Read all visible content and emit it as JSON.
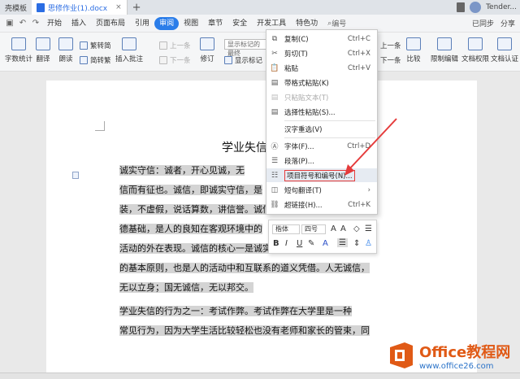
{
  "titlebar": {
    "tab1": "壳模板",
    "tab2": "思修作业(1).docx",
    "user": "Tender..."
  },
  "menubar": {
    "items": [
      "开始",
      "插入",
      "页面布局",
      "引用",
      "审阅",
      "视图",
      "章节",
      "安全",
      "开发工具",
      "特色功"
    ],
    "search": "编号",
    "sync": "已同步",
    "share": "分享"
  },
  "ribbon": {
    "word_count": "字数统计",
    "translate": "翻译",
    "read_aloud": "朗读",
    "trad_to_simp": "繁转简",
    "simp_to_trad": "简转繁",
    "insert_comment": "插入批注",
    "prev": "上一条",
    "next": "下一条",
    "revise": "修订",
    "show_markup": "显示标记的最终",
    "show_markup_opt": "显示标记",
    "prev2": "上一条",
    "next2": "下一条",
    "compare": "比较",
    "restrict": "限制编辑",
    "doc_rights": "文档权限",
    "doc_cert": "文档认证"
  },
  "document": {
    "title": "学业失信",
    "lines": [
      "诚实守信：诚者，开心见诚，无",
      "信而有征也。诚信，即诚实守信，是",
      "装，不虚假，说话算数，讲信誉。诚信是一个社会赖以存在的道",
      "德基础，是人的良知在客观环境中的",
      "活动的外在表现。诚信的核心一是诚实，二是守信。诚信是做人",
      "的基本原则，也是人的活动中和互联系的道义凭借。人无诚信，",
      "无以立身；国无诚信，无以邦交。",
      "学业失信的行为之一：考试作弊。考试作弊在大学里是一种",
      "常见行为，因为大学生活比较轻松也没有老师和家长的管束，同"
    ]
  },
  "context_menu": {
    "items": [
      {
        "label": "复制(C)",
        "shortcut": "Ctrl+C"
      },
      {
        "label": "剪切(T)",
        "shortcut": "Ctrl+X"
      },
      {
        "label": "粘贴",
        "shortcut": "Ctrl+V"
      },
      {
        "label": "带格式粘贴(K)",
        "shortcut": ""
      },
      {
        "label": "只粘贴文本(T)",
        "shortcut": ""
      },
      {
        "label": "选择性粘贴(S)...",
        "shortcut": ""
      },
      {
        "label": "汉字重选(V)",
        "shortcut": ""
      },
      {
        "label": "字体(F)...",
        "shortcut": "Ctrl+D"
      },
      {
        "label": "段落(P)...",
        "shortcut": ""
      },
      {
        "label": "项目符号和编号(N)...",
        "shortcut": ""
      },
      {
        "label": "短句翻译(T)",
        "shortcut": ""
      },
      {
        "label": "超链接(H)...",
        "shortcut": "Ctrl+K"
      }
    ]
  },
  "mini_toolbar": {
    "font": "楷体",
    "size": "四号",
    "bold": "B",
    "italic": "I",
    "underline": "U"
  },
  "watermark": {
    "line1": "Office教程网",
    "line2": "www.office26.com"
  },
  "colors": {
    "accent": "#2b7de9",
    "highlight_box": "#e53b3b",
    "selection": "#d4d4d4",
    "watermark_orange": "#e05a16",
    "watermark_blue": "#2b73c8"
  }
}
